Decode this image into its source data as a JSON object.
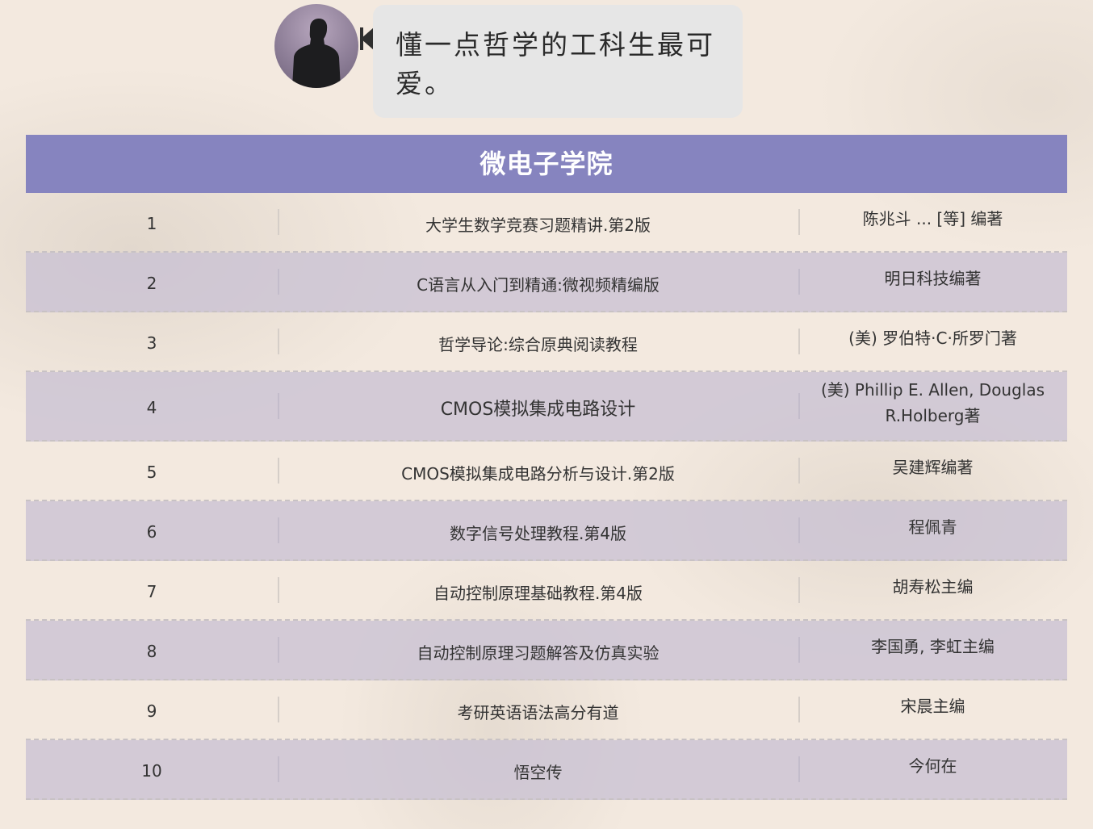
{
  "bubble": {
    "line1": "懂一点哲学的工科生最可",
    "line2": "爱。"
  },
  "table": {
    "title": "微电子学院",
    "rows": [
      {
        "num": "1",
        "title": "大学生数学竞赛习题精讲.第2版",
        "author": "陈兆斗 ... [等] 编著"
      },
      {
        "num": "2",
        "title": "C语言从入门到精通:微视频精编版",
        "author": "明日科技编著"
      },
      {
        "num": "3",
        "title": "哲学导论:综合原典阅读教程",
        "author": "(美) 罗伯特·C·所罗门著"
      },
      {
        "num": "4",
        "title": "CMOS模拟集成电路设计",
        "author": "(美) Phillip E. Allen, Douglas R.Holberg著"
      },
      {
        "num": "5",
        "title": "CMOS模拟集成电路分析与设计.第2版",
        "author": "吴建辉编著"
      },
      {
        "num": "6",
        "title": "数字信号处理教程.第4版",
        "author": "程佩青"
      },
      {
        "num": "7",
        "title": "自动控制原理基础教程.第4版",
        "author": "胡寿松主编"
      },
      {
        "num": "8",
        "title": "自动控制原理习题解答及仿真实验",
        "author": "李国勇, 李虹主编"
      },
      {
        "num": "9",
        "title": "考研英语语法高分有道",
        "author": "宋晨主编"
      },
      {
        "num": "10",
        "title": "悟空传",
        "author": "今何在"
      }
    ]
  },
  "colors": {
    "header_bg": "#8684bf",
    "alt_row_bg": "#c9c1d4",
    "bubble_bg": "#e6e6e6",
    "page_bg": "#f3e9df"
  }
}
